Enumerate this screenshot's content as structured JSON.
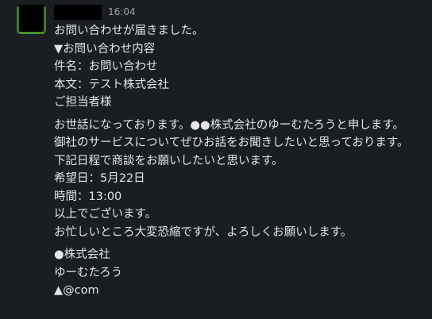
{
  "message": {
    "sender_name": "",
    "timestamp": "16:04",
    "paragraphs": [
      {
        "lines": [
          "お問い合わせが届きました。",
          "▼お問い合わせ内容",
          "件名：お問い合わせ",
          "本文：テスト株式会社",
          "ご担当者様"
        ]
      },
      {
        "lines": [
          "お世話になっております。●●株式会社のゆーむたろうと申します。",
          "御社のサービスについてぜひお話をお聞きしたいと思っております。",
          "下記日程で商談をお願いしたいと思います。",
          "希望日：5月22日",
          "時間：13:00",
          "以上でございます。",
          "お忙しいところ大変恐縮ですが、よろしくお願いします。"
        ]
      },
      {
        "lines": [
          "●株式会社",
          "ゆーむたろう",
          "▲@com"
        ]
      }
    ]
  }
}
